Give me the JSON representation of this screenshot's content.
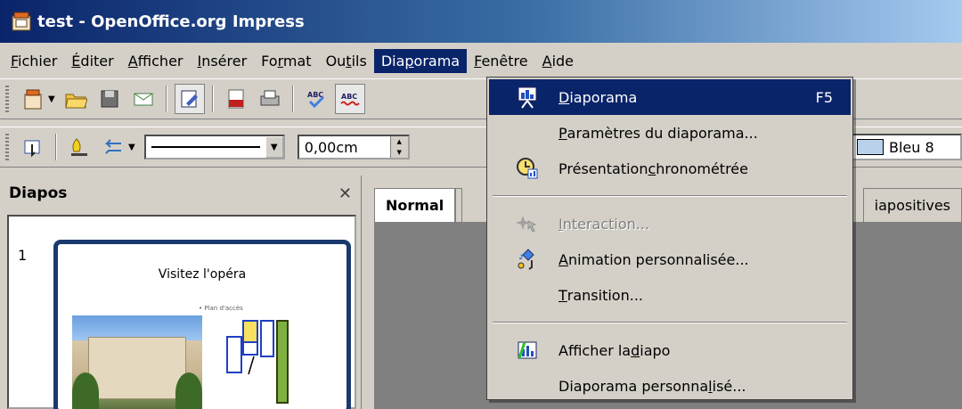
{
  "window": {
    "title": "test - OpenOffice.org Impress"
  },
  "menubar": {
    "items": [
      {
        "pre": "",
        "ul": "F",
        "post": "ichier"
      },
      {
        "pre": "",
        "ul": "É",
        "post": "diter"
      },
      {
        "pre": "",
        "ul": "A",
        "post": "fficher"
      },
      {
        "pre": "",
        "ul": "I",
        "post": "nsérer"
      },
      {
        "pre": "Fo",
        "ul": "r",
        "post": "mat"
      },
      {
        "pre": "Ou",
        "ul": "t",
        "post": "ils"
      },
      {
        "pre": "Dia",
        "ul": "p",
        "post": "orama"
      },
      {
        "pre": "",
        "ul": "F",
        "post": "enêtre"
      },
      {
        "pre": "",
        "ul": "A",
        "post": "ide"
      }
    ]
  },
  "toolbar2": {
    "line_width": "0,00cm",
    "area_color": "Bleu 8"
  },
  "slides_panel": {
    "title": "Diapos",
    "slide_number": "1",
    "slide_title": "Visitez l'opéra",
    "slide_bullet": "• Plan d'accès"
  },
  "tabs": {
    "normal": "Normal",
    "slide_sorter_fragment": "iapositives"
  },
  "dropdown": {
    "items": [
      {
        "pre": "",
        "ul": "D",
        "post": "iaporama",
        "shortcut": "F5",
        "icon": "slideshow-icon",
        "state": "highlighted"
      },
      {
        "pre": "",
        "ul": "P",
        "post": "aramètres du diaporama...",
        "shortcut": "",
        "icon": "",
        "state": "normal"
      },
      {
        "pre": "Présentation ",
        "ul": "c",
        "post": "hronométrée",
        "shortcut": "",
        "icon": "rehearse-timings-icon",
        "state": "normal"
      },
      {
        "pre": "",
        "ul": "I",
        "post": "nteraction...",
        "shortcut": "",
        "icon": "interaction-icon",
        "state": "disabled"
      },
      {
        "pre": "",
        "ul": "A",
        "post": "nimation personnalisée...",
        "shortcut": "",
        "icon": "custom-animation-icon",
        "state": "normal"
      },
      {
        "pre": "",
        "ul": "T",
        "post": "ransition...",
        "shortcut": "",
        "icon": "",
        "state": "normal"
      },
      {
        "pre": "Afficher la ",
        "ul": "d",
        "post": "iapo",
        "shortcut": "",
        "icon": "show-slide-icon",
        "state": "normal"
      },
      {
        "pre": "Diaporama personna",
        "ul": "l",
        "post": "isé...",
        "shortcut": "",
        "icon": "",
        "state": "normal"
      }
    ]
  },
  "colors": {
    "titlebar": "#0a246a",
    "highlight": "#0a246a",
    "face": "#d4d0c8"
  }
}
